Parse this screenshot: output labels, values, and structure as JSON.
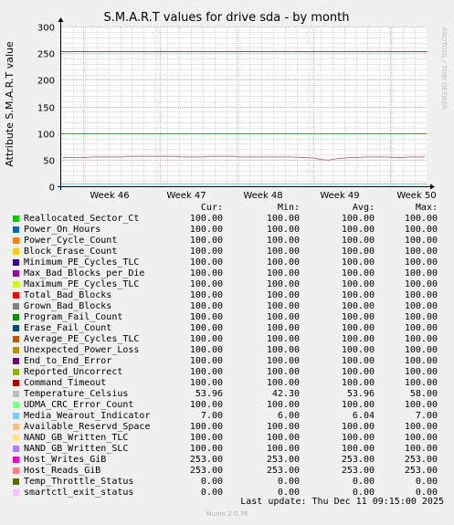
{
  "chart_data": {
    "type": "line",
    "title": "S.M.A.R.T values for drive sda - by month",
    "ylabel": "Attribute S.M.A.R.T value",
    "xlabel": "",
    "ylim": [
      0,
      300
    ],
    "yticks": [
      0,
      50,
      100,
      150,
      200,
      250,
      300
    ],
    "xticks": [
      "Week 46",
      "Week 47",
      "Week 48",
      "Week 49",
      "Week 50"
    ],
    "grid": true,
    "side_note": "RRDTOOL / TOBI OETIKER",
    "plotted_lines": [
      {
        "series": "Host_Writes_GiB",
        "value": 253
      },
      {
        "series": "Reallocated_Sector_Ct",
        "value": 100
      },
      {
        "series": "Temperature_Celsius",
        "trend": [
          54,
          54,
          54,
          54,
          55,
          55,
          55,
          55,
          55,
          56,
          56,
          56,
          56,
          56,
          56,
          56,
          55,
          55,
          55,
          55,
          56,
          56,
          56,
          56,
          55,
          55,
          55,
          55,
          55,
          55,
          55,
          55,
          54,
          54,
          53,
          50,
          49,
          52,
          53,
          54,
          54,
          55,
          55,
          55,
          55,
          54,
          54,
          55,
          55,
          55
        ]
      },
      {
        "series": "Media_Wearout_Indicator",
        "value": 6
      },
      {
        "series": "Temp_Throttle_Status",
        "value": 0
      }
    ]
  },
  "legend": {
    "headers": {
      "cur": "Cur:",
      "min": "Min:",
      "avg": "Avg:",
      "max": "Max:"
    },
    "rows": [
      {
        "name": "Reallocated_Sector_Ct",
        "color": "#00cc00",
        "cur": "100.00",
        "min": "100.00",
        "avg": "100.00",
        "max": "100.00"
      },
      {
        "name": "Power_On_Hours",
        "color": "#0066b3",
        "cur": "100.00",
        "min": "100.00",
        "avg": "100.00",
        "max": "100.00"
      },
      {
        "name": "Power_Cycle_Count",
        "color": "#ff8000",
        "cur": "100.00",
        "min": "100.00",
        "avg": "100.00",
        "max": "100.00"
      },
      {
        "name": "Block_Erase_Count",
        "color": "#ffcc00",
        "cur": "100.00",
        "min": "100.00",
        "avg": "100.00",
        "max": "100.00"
      },
      {
        "name": "Minimum_PE_Cycles_TLC",
        "color": "#330099",
        "cur": "100.00",
        "min": "100.00",
        "avg": "100.00",
        "max": "100.00"
      },
      {
        "name": "Max_Bad_Blocks_per_Die",
        "color": "#990099",
        "cur": "100.00",
        "min": "100.00",
        "avg": "100.00",
        "max": "100.00"
      },
      {
        "name": "Maximum_PE_Cycles_TLC",
        "color": "#ccff00",
        "cur": "100.00",
        "min": "100.00",
        "avg": "100.00",
        "max": "100.00"
      },
      {
        "name": "Total_Bad_Blocks",
        "color": "#ff0000",
        "cur": "100.00",
        "min": "100.00",
        "avg": "100.00",
        "max": "100.00"
      },
      {
        "name": "Grown_Bad_Blocks",
        "color": "#808080",
        "cur": "100.00",
        "min": "100.00",
        "avg": "100.00",
        "max": "100.00"
      },
      {
        "name": "Program_Fail_Count",
        "color": "#008f00",
        "cur": "100.00",
        "min": "100.00",
        "avg": "100.00",
        "max": "100.00"
      },
      {
        "name": "Erase_Fail_Count",
        "color": "#00487d",
        "cur": "100.00",
        "min": "100.00",
        "avg": "100.00",
        "max": "100.00"
      },
      {
        "name": "Average_PE_Cycles_TLC",
        "color": "#b35a00",
        "cur": "100.00",
        "min": "100.00",
        "avg": "100.00",
        "max": "100.00"
      },
      {
        "name": "Unexpected_Power_Loss",
        "color": "#b38f00",
        "cur": "100.00",
        "min": "100.00",
        "avg": "100.00",
        "max": "100.00"
      },
      {
        "name": "End_to_End_Error",
        "color": "#6b006b",
        "cur": "100.00",
        "min": "100.00",
        "avg": "100.00",
        "max": "100.00"
      },
      {
        "name": "Reported_Uncorrect",
        "color": "#8fb300",
        "cur": "100.00",
        "min": "100.00",
        "avg": "100.00",
        "max": "100.00"
      },
      {
        "name": "Command_Timeout",
        "color": "#b30000",
        "cur": "100.00",
        "min": "100.00",
        "avg": "100.00",
        "max": "100.00"
      },
      {
        "name": "Temperature_Celsius",
        "color": "#bebebe",
        "cur": "53.96",
        "min": "42.30",
        "avg": "53.96",
        "max": "58.00"
      },
      {
        "name": "UDMA_CRC_Error_Count",
        "color": "#80ff80",
        "cur": "100.00",
        "min": "100.00",
        "avg": "100.00",
        "max": "100.00"
      },
      {
        "name": "Media_Wearout_Indicator",
        "color": "#80c9ff",
        "cur": "7.00",
        "min": "6.00",
        "avg": "6.04",
        "max": "7.00"
      },
      {
        "name": "Available_Reservd_Space",
        "color": "#ffc080",
        "cur": "100.00",
        "min": "100.00",
        "avg": "100.00",
        "max": "100.00"
      },
      {
        "name": "NAND_GB_Written_TLC",
        "color": "#ffe680",
        "cur": "100.00",
        "min": "100.00",
        "avg": "100.00",
        "max": "100.00"
      },
      {
        "name": "NAND_GB_Written_SLC",
        "color": "#aa80ff",
        "cur": "100.00",
        "min": "100.00",
        "avg": "100.00",
        "max": "100.00"
      },
      {
        "name": "Host_Writes_GiB",
        "color": "#ee00cc",
        "cur": "253.00",
        "min": "253.00",
        "avg": "253.00",
        "max": "253.00"
      },
      {
        "name": "Host_Reads_GiB",
        "color": "#ff8080",
        "cur": "253.00",
        "min": "253.00",
        "avg": "253.00",
        "max": "253.00"
      },
      {
        "name": "Temp_Throttle_Status",
        "color": "#666600",
        "cur": "0.00",
        "min": "0.00",
        "avg": "0.00",
        "max": "0.00"
      },
      {
        "name": "smartctl_exit_status",
        "color": "#ffbfff",
        "cur": "0.00",
        "min": "0.00",
        "avg": "0.00",
        "max": "0.00"
      }
    ],
    "last_update": "Last update: Thu Dec 11 09:15:00 2025"
  },
  "footer": "Munin 2.0.76",
  "colors": {
    "background": "#f0f0f0",
    "plot_bg": "#ffffff",
    "grid": "#e0c8c8",
    "axis": "#000000"
  }
}
